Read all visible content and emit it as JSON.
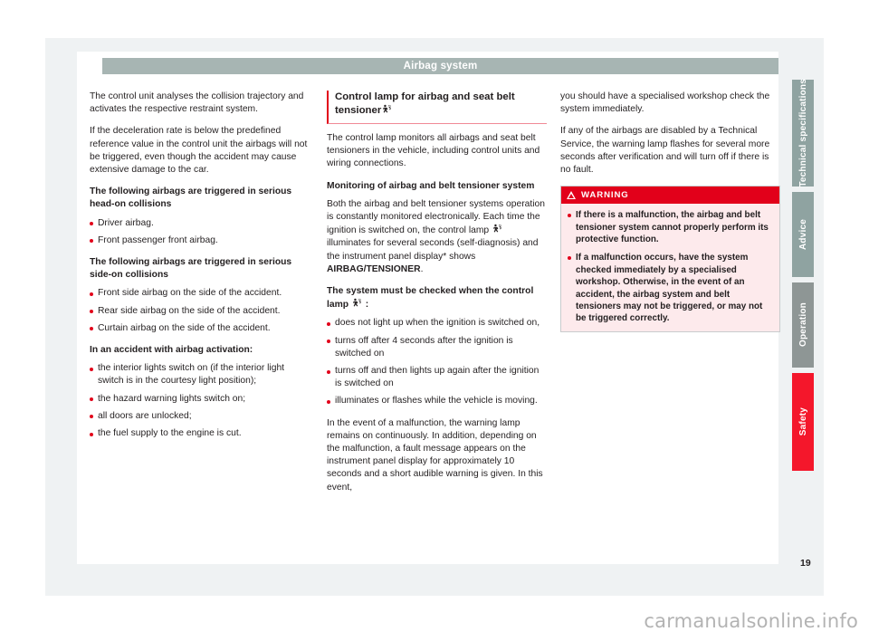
{
  "document": {
    "running_head": "Airbag system",
    "page_number": "19",
    "watermark": "carmanualsonline.info"
  },
  "icons": {
    "airbag_pictogram": "airbag-icon",
    "warning_triangle": "warning-triangle-icon"
  },
  "colors": {
    "accent_red": "#e2001a",
    "safety_tab_red": "#f4172b",
    "head_bar_gray": "#a7b5b3",
    "tab_gray": "#8fa3a1",
    "board_gray": "#eff2f3",
    "warning_box_bg": "#fdeaec"
  },
  "columns": {
    "left": {
      "paragraph_1": "The control unit analyses the collision trajectory and activates the respective restraint system.",
      "paragraph_2": "If the deceleration rate is below the predefined reference value in the control unit the airbags will not be triggered, even though the accident may cause extensive damage to the car.",
      "heading_head_on": "The following airbags are triggered in serious head-on collisions",
      "bullets_head_on": [
        "Driver airbag.",
        "Front passenger front airbag."
      ],
      "heading_side_on": "The following airbags are triggered in serious side-on collisions",
      "bullets_side_on": [
        "Front side airbag on the side of the accident.",
        "Rear side airbag on the side of the accident.",
        "Curtain airbag on the side of the accident."
      ],
      "heading_activation": "In an accident with airbag activation:",
      "bullets_activation": [
        "the interior lights switch on (if the interior light switch is in the courtesy light position);",
        "the hazard warning lights switch on;",
        "all doors are unlocked;",
        "the fuel supply to the engine is cut."
      ]
    },
    "middle": {
      "section_heading": "Control lamp for airbag and seat belt tensioner",
      "paragraph_1": "The control lamp monitors all airbags and seat belt tensioners in the vehicle, including control units and wiring connections.",
      "heading_monitoring": "Monitoring of airbag and belt tensioner system",
      "paragraph_2_part_1": "Both the airbag and belt tensioner systems operation is constantly monitored electronically. Each time the ignition is switched on, the control lamp",
      "paragraph_2_part_2": "illuminates for several seconds (self-diagnosis) and the instrument panel display* shows",
      "paragraph_2_emphasis": "AIRBAG/TENSIONER",
      "paragraph_2_part_3": ".",
      "heading_check_part_1": "The system must be checked when the control lamp",
      "heading_check_part_2": ":",
      "bullets_check": [
        "does not light up when the ignition is switched on,",
        "turns off after 4 seconds after the ignition is switched on",
        "turns off and then lights up again after the ignition is switched on",
        "illuminates or flashes while the vehicle is moving."
      ],
      "paragraph_3": "In the event of a malfunction, the warning lamp remains on continuously. In addition, depending on the malfunction, a fault message appears on the instrument panel display for approximately 10 seconds and a short audible warning is given. In this event,"
    },
    "right": {
      "paragraph_1": "you should have a specialised workshop check the system immediately.",
      "paragraph_2": "If any of the airbags are disabled by a Technical Service, the warning lamp flashes for several more seconds after verification and will turn off if there is no fault.",
      "warning": {
        "title": "WARNING",
        "bullets": [
          "If there is a malfunction, the airbag and belt tensioner system cannot properly perform its protective function.",
          "If a malfunction occurs, have the system checked immediately by a specialised workshop. Otherwise, in the event of an accident, the airbag system and belt tensioners may not be triggered, or may not be triggered correctly."
        ]
      }
    }
  },
  "side_tabs": [
    {
      "label": "Technical specifications",
      "active": false
    },
    {
      "label": "Advice",
      "active": false
    },
    {
      "label": "Operation",
      "active": false
    },
    {
      "label": "Safety",
      "active": true
    }
  ]
}
